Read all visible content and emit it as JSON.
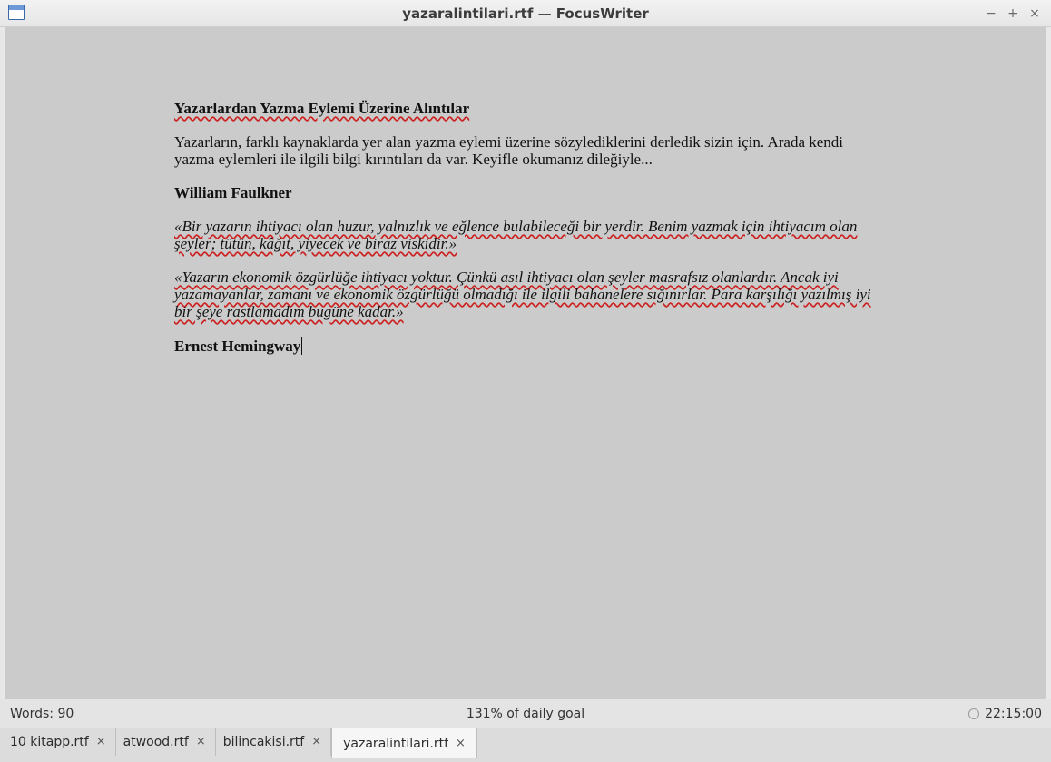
{
  "window": {
    "title": "yazaralintilari.rtf — FocusWriter",
    "controls": {
      "minimize": "−",
      "maximize": "+",
      "close": "×"
    }
  },
  "document": {
    "heading": "Yazarlardan Yazma Eylemi Üzerine Alıntılar",
    "intro": "Yazarların, farklı kaynaklarda yer alan yazma eylemi üzerine sözylediklerini derledik sizin için. Arada kendi yazma eylemleri ile ilgili bilgi kırıntıları da var. Keyifle okumanız dileğiyle...",
    "author1": "William Faulkner",
    "quote1": "«Bir yazarın ihtiyacı olan huzur, yalnızlık  ve eğlence bulabileceği bir yerdir. Benim yazmak için ihtiyacım olan şeyler; tütün, kâğıt, yiyecek ve biraz viskidir.»",
    "quote2": "«Yazarın ekonomik özgürlüğe ihtiyacı yoktur. Çünkü asıl ihtiyacı olan şeyler masrafsız olanlardır. Ancak iyi yazamayanlar, zamanı ve ekonomik özgürlüğü olmadığı ile ilgili bahanelere sığınırlar. Para karşılığı yazılmış iyi bir şeye rastlamadım bugüne kadar.»",
    "author2": "Ernest Hemingway"
  },
  "statusbar": {
    "words": "Words: 90",
    "goal": "131% of daily goal",
    "clock": "22:15:00"
  },
  "tabs": [
    {
      "label": "10 kitapp.rtf",
      "close": "×",
      "active": false
    },
    {
      "label": "atwood.rtf",
      "close": "×",
      "active": false
    },
    {
      "label": "bilincakisi.rtf",
      "close": "×",
      "active": false
    },
    {
      "label": "yazaralintilari.rtf",
      "close": "×",
      "active": true
    }
  ]
}
